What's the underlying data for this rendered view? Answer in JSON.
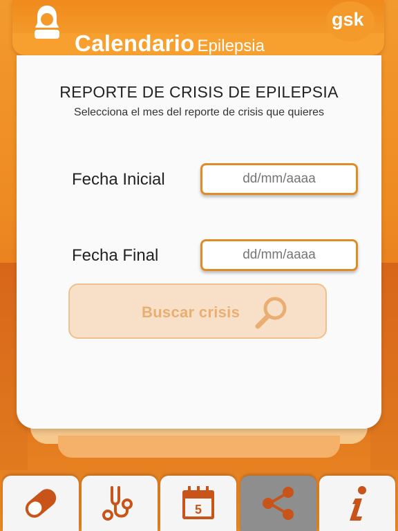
{
  "header": {
    "brand_main": "Calendario",
    "brand_sub": "Epilepsia",
    "logo_text": "gsk"
  },
  "report": {
    "title": "REPORTE DE CRISIS DE EPILEPSIA",
    "subtitle": "Selecciona el mes del reporte de crisis que quieres"
  },
  "form": {
    "start_label": "Fecha Inicial",
    "start_placeholder": "dd/mm/aaaa",
    "end_label": "Fecha Final",
    "end_placeholder": "dd/mm/aaaa",
    "search_label": "Buscar crisis"
  },
  "tabs": [
    {
      "icon": "pill-icon",
      "active": false
    },
    {
      "icon": "stethoscope-icon",
      "active": false
    },
    {
      "icon": "calendar-icon",
      "day": "5",
      "active": false
    },
    {
      "icon": "share-icon",
      "active": true
    },
    {
      "icon": "info-icon",
      "active": false
    }
  ],
  "colors": {
    "accent": "#f08a1c",
    "accent_dark": "#c8541a",
    "card": "#fafafa",
    "active_tab": "#8e8e8e"
  }
}
